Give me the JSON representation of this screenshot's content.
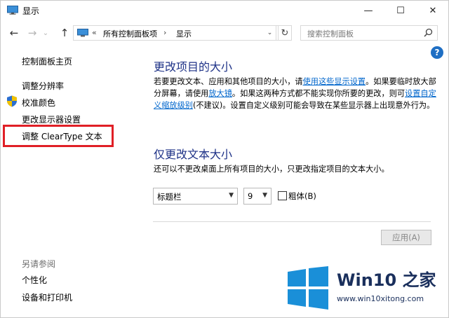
{
  "window": {
    "title": "显示",
    "minimize_glyph": "—",
    "maximize_glyph": "☐",
    "close_glyph": "✕"
  },
  "nav": {
    "back_glyph": "←",
    "forward_glyph": "→",
    "history_glyph": "⌄",
    "up_glyph": "↑"
  },
  "address": {
    "chevron": "«",
    "crumbs": [
      "所有控制面板项",
      "显示"
    ],
    "separator": "›",
    "dropdown_glyph": "⌄",
    "refresh_glyph": "↻"
  },
  "search": {
    "placeholder": "搜索控制面板",
    "icon": "search-icon"
  },
  "help": {
    "label": "?"
  },
  "sidebar": {
    "home": "控制面板主页",
    "items": [
      {
        "label": "调整分辨率"
      },
      {
        "label": "校准颜色",
        "icon": "shield-icon"
      },
      {
        "label": "更改显示器设置"
      },
      {
        "label": "调整 ClearType 文本"
      }
    ],
    "see_also_title": "另请参阅",
    "see_also": [
      {
        "label": "个性化"
      },
      {
        "label": "设备和打印机"
      }
    ]
  },
  "main": {
    "section1_title": "更改项目的大小",
    "p1_a": "若要更改文本、应用和其他项目的大小，请",
    "p1_link1": "使用这些显示设置",
    "p1_b": "。如果要临时放大部分屏幕，请使用",
    "p1_link2": "放大镜",
    "p1_c": "。如果这两种方式都不能实现你所要的更改，则可",
    "p1_link3": "设置自定义缩放级别",
    "p1_d": "(不建议)。设置自定义级别可能会导致在某些显示器上出现意外行为。",
    "section2_title": "仅更改文本大小",
    "p2": "还可以不更改桌面上所有项目的大小，只更改指定项目的文本大小。",
    "item_select": "标题栏",
    "size_select": "9",
    "bold_label": "粗体(B)",
    "bold_checked": false,
    "apply_label": "应用(A)"
  },
  "watermark": {
    "title": "Win10 之家",
    "url": "www.win10xitong.com"
  },
  "colors": {
    "heading": "#1e3287",
    "link": "#0066cc",
    "highlight": "#e01f26",
    "logo_blue": "#1a8fd8"
  }
}
